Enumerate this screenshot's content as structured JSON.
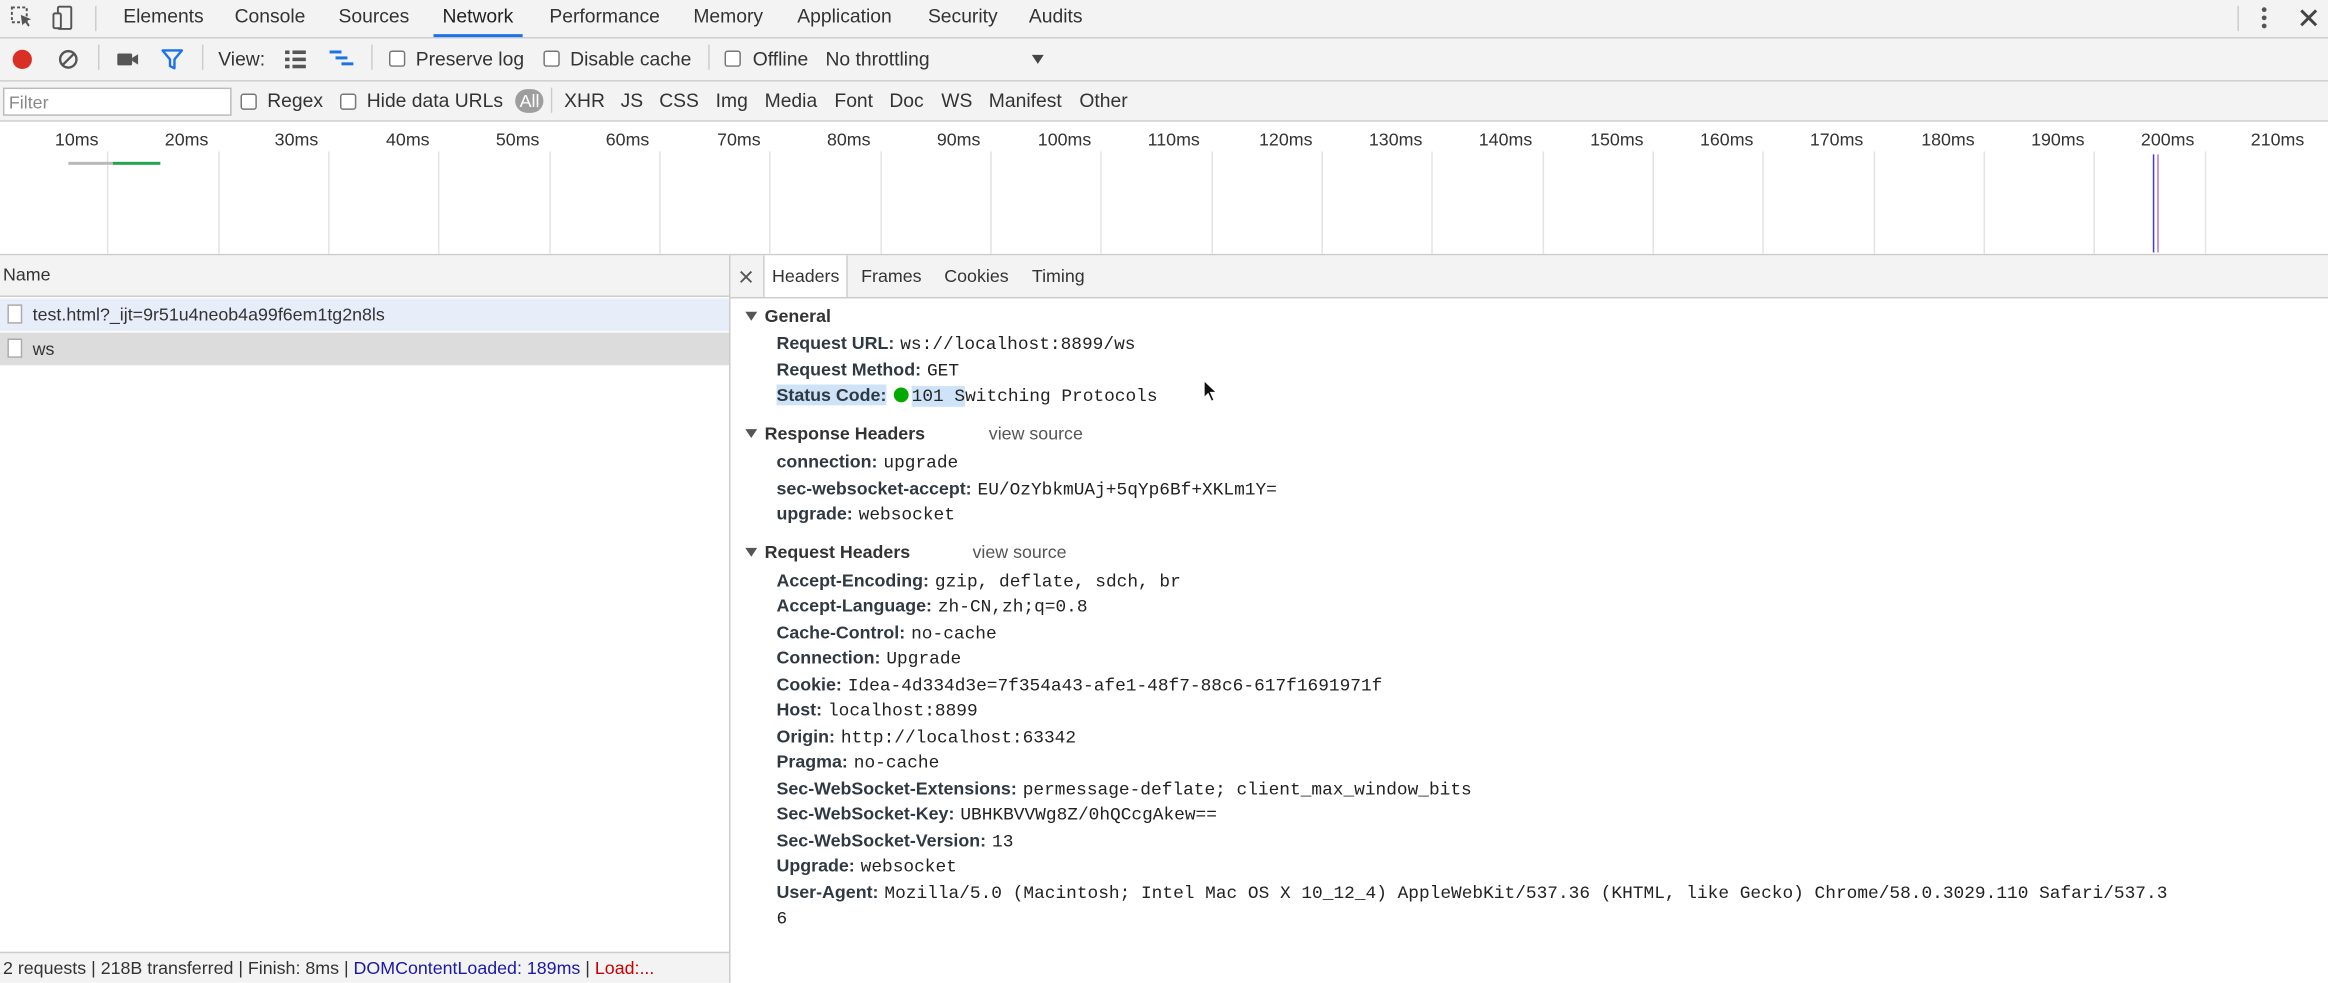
{
  "tabs": [
    "Elements",
    "Console",
    "Sources",
    "Network",
    "Performance",
    "Memory",
    "Application",
    "Security",
    "Audits"
  ],
  "toolbar": {
    "view_label": "View:",
    "preserve_log": "Preserve log",
    "disable_cache": "Disable cache",
    "offline": "Offline",
    "throttling": "No throttling"
  },
  "filter": {
    "placeholder": "Filter",
    "regex": "Regex",
    "hide_data_urls": "Hide data URLs",
    "types": [
      "All",
      "XHR",
      "JS",
      "CSS",
      "Img",
      "Media",
      "Font",
      "Doc",
      "WS",
      "Manifest",
      "Other"
    ]
  },
  "timeline": {
    "ticks": [
      "10ms",
      "20ms",
      "30ms",
      "40ms",
      "50ms",
      "60ms",
      "70ms",
      "80ms",
      "90ms",
      "100ms",
      "110ms",
      "120ms",
      "130ms",
      "140ms",
      "150ms",
      "160ms",
      "170ms",
      "180ms",
      "190ms",
      "200ms",
      "210ms"
    ]
  },
  "list": {
    "header": "Name",
    "rows": [
      "test.html?_ijt=9r51u4neob4a99f6em1tg2n8ls",
      "ws"
    ]
  },
  "summary": {
    "part1": "2 requests | 218B transferred | Finish: 8ms | ",
    "dom": "DOMContentLoaded: 189ms",
    "part2": " | ",
    "load": "Load:..."
  },
  "detail": {
    "tabs": [
      "Headers",
      "Frames",
      "Cookies",
      "Timing"
    ],
    "general": {
      "title": "General",
      "request_url_key": "Request URL:",
      "request_url": "ws://localhost:8899/ws",
      "method_key": "Request Method:",
      "method": "GET",
      "status_key": "Status Code:",
      "status_sel": "101 S",
      "status_rest": "witching Protocols"
    },
    "response": {
      "title": "Response Headers",
      "view_source": "view source",
      "headers": [
        {
          "k": "connection:",
          "v": "upgrade"
        },
        {
          "k": "sec-websocket-accept:",
          "v": "EU/OzYbkmUAj+5qYp6Bf+XKLm1Y="
        },
        {
          "k": "upgrade:",
          "v": "websocket"
        }
      ]
    },
    "request": {
      "title": "Request Headers",
      "view_source": "view source",
      "headers": [
        {
          "k": "Accept-Encoding:",
          "v": "gzip, deflate, sdch, br"
        },
        {
          "k": "Accept-Language:",
          "v": "zh-CN,zh;q=0.8"
        },
        {
          "k": "Cache-Control:",
          "v": "no-cache"
        },
        {
          "k": "Connection:",
          "v": "Upgrade"
        },
        {
          "k": "Cookie:",
          "v": "Idea-4d334d3e=7f354a43-afe1-48f7-88c6-617f1691971f"
        },
        {
          "k": "Host:",
          "v": "localhost:8899"
        },
        {
          "k": "Origin:",
          "v": "http://localhost:63342"
        },
        {
          "k": "Pragma:",
          "v": "no-cache"
        },
        {
          "k": "Sec-WebSocket-Extensions:",
          "v": "permessage-deflate; client_max_window_bits"
        },
        {
          "k": "Sec-WebSocket-Key:",
          "v": "UBHKBVVWg8Z/0hQCcgAkew=="
        },
        {
          "k": "Sec-WebSocket-Version:",
          "v": "13"
        },
        {
          "k": "Upgrade:",
          "v": "websocket"
        },
        {
          "k": "User-Agent:",
          "v": "Mozilla/5.0 (Macintosh; Intel Mac OS X 10_12_4) AppleWebKit/537.36 (KHTML, like Gecko) Chrome/58.0.3029.110 Safari/537.3"
        }
      ],
      "user_agent_wrap": "6"
    }
  },
  "colors": {
    "accent": "#1a73e8",
    "record": "#d93025",
    "status_ok": "#00aa00",
    "dom_content_loaded": "#1a1aa6",
    "load": "#c80000",
    "selection": "#cfe3f8"
  }
}
